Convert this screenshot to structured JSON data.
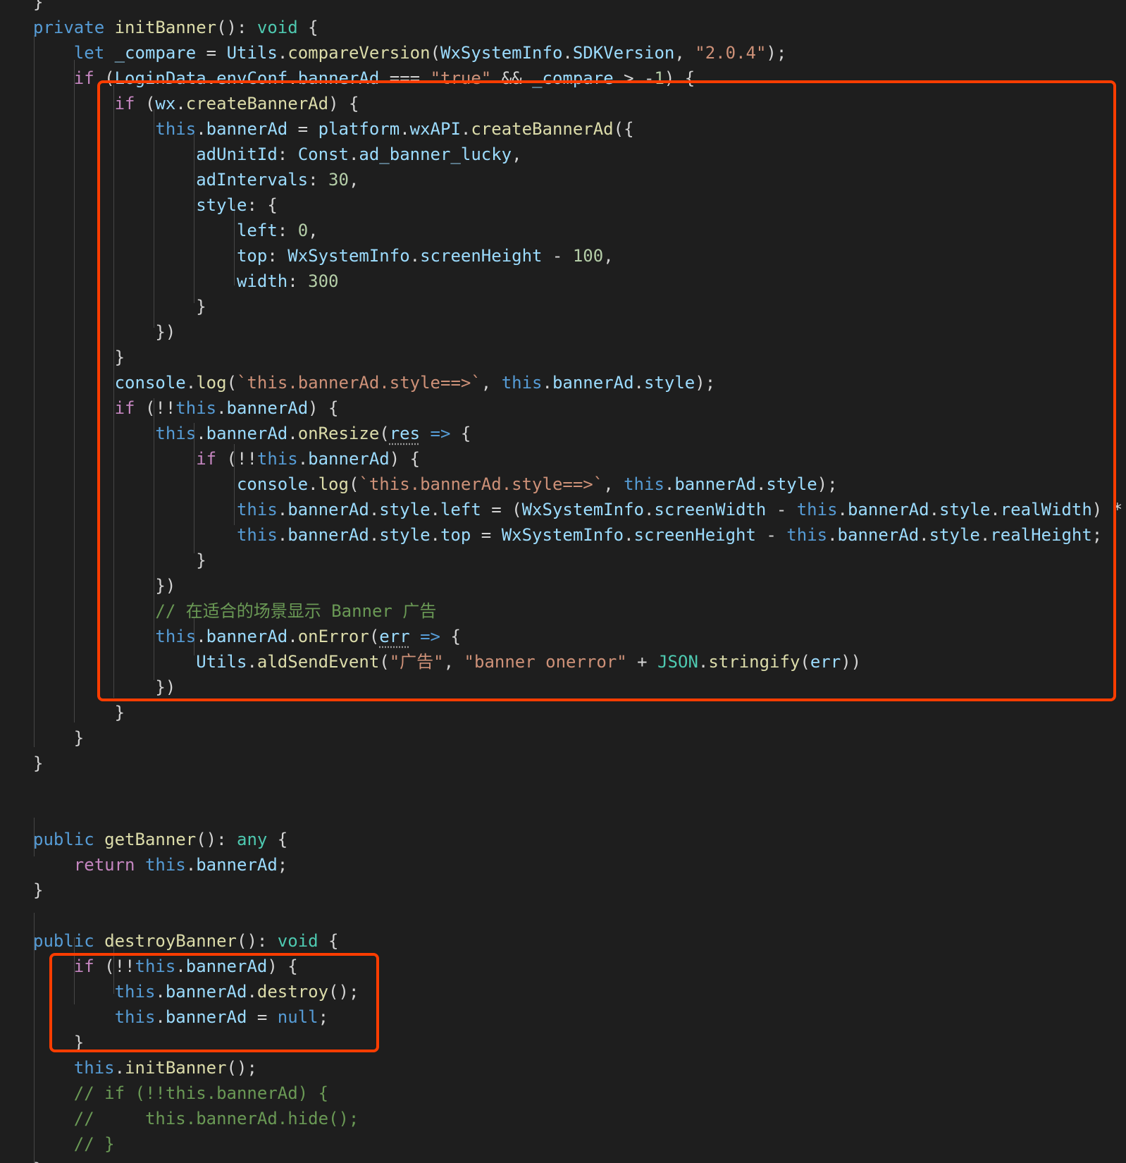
{
  "colors": {
    "background": "#1e1e1e",
    "keyword_control": "#c586c0",
    "keyword_storage": "#569cd6",
    "function": "#dcdcaa",
    "variable": "#9cdcfe",
    "class_type": "#4ec9b0",
    "string": "#ce9178",
    "number": "#b5cea8",
    "comment": "#6a9955",
    "punctuation": "#d4d4d4",
    "highlight_border": "#ff3d00"
  },
  "code": {
    "lines": [
      [
        {
          "t": "}",
          "c": "p"
        }
      ],
      [
        {
          "t": "private",
          "c": "s"
        },
        {
          "t": " "
        },
        {
          "t": "initBanner",
          "c": "f"
        },
        {
          "t": "(): "
        },
        {
          "t": "void",
          "c": "ty"
        },
        {
          "t": " {"
        }
      ],
      [
        {
          "t": "    "
        },
        {
          "t": "let",
          "c": "s"
        },
        {
          "t": " "
        },
        {
          "t": "_compare",
          "c": "v"
        },
        {
          "t": " = "
        },
        {
          "t": "Utils",
          "c": "v"
        },
        {
          "t": "."
        },
        {
          "t": "compareVersion",
          "c": "f"
        },
        {
          "t": "("
        },
        {
          "t": "WxSystemInfo",
          "c": "v"
        },
        {
          "t": "."
        },
        {
          "t": "SDKVersion",
          "c": "v"
        },
        {
          "t": ", "
        },
        {
          "t": "\"2.0.4\"",
          "c": "str"
        },
        {
          "t": ");"
        }
      ],
      [
        {
          "t": "    "
        },
        {
          "t": "if",
          "c": "k"
        },
        {
          "t": " ("
        },
        {
          "t": "LoginData",
          "c": "v"
        },
        {
          "t": "."
        },
        {
          "t": "envConf",
          "c": "v"
        },
        {
          "t": "."
        },
        {
          "t": "bannerAd",
          "c": "v"
        },
        {
          "t": " === "
        },
        {
          "t": "\"true\"",
          "c": "str"
        },
        {
          "t": " && "
        },
        {
          "t": "_compare",
          "c": "v"
        },
        {
          "t": " > -"
        },
        {
          "t": "1",
          "c": "n"
        },
        {
          "t": ") {"
        }
      ],
      [
        {
          "t": "        "
        },
        {
          "t": "if",
          "c": "k"
        },
        {
          "t": " ("
        },
        {
          "t": "wx",
          "c": "v"
        },
        {
          "t": "."
        },
        {
          "t": "createBannerAd",
          "c": "f"
        },
        {
          "t": ") {"
        }
      ],
      [
        {
          "t": "            "
        },
        {
          "t": "this",
          "c": "s"
        },
        {
          "t": "."
        },
        {
          "t": "bannerAd",
          "c": "v"
        },
        {
          "t": " = "
        },
        {
          "t": "platform",
          "c": "v"
        },
        {
          "t": "."
        },
        {
          "t": "wxAPI",
          "c": "v"
        },
        {
          "t": "."
        },
        {
          "t": "createBannerAd",
          "c": "f"
        },
        {
          "t": "({"
        }
      ],
      [
        {
          "t": "                "
        },
        {
          "t": "adUnitId",
          "c": "v"
        },
        {
          "t": ": "
        },
        {
          "t": "Const",
          "c": "v"
        },
        {
          "t": "."
        },
        {
          "t": "ad_banner_lucky",
          "c": "v"
        },
        {
          "t": ","
        }
      ],
      [
        {
          "t": "                "
        },
        {
          "t": "adIntervals",
          "c": "v"
        },
        {
          "t": ": "
        },
        {
          "t": "30",
          "c": "n"
        },
        {
          "t": ","
        }
      ],
      [
        {
          "t": "                "
        },
        {
          "t": "style",
          "c": "v"
        },
        {
          "t": ": {"
        }
      ],
      [
        {
          "t": "                    "
        },
        {
          "t": "left",
          "c": "v"
        },
        {
          "t": ": "
        },
        {
          "t": "0",
          "c": "n"
        },
        {
          "t": ","
        }
      ],
      [
        {
          "t": "                    "
        },
        {
          "t": "top",
          "c": "v"
        },
        {
          "t": ": "
        },
        {
          "t": "WxSystemInfo",
          "c": "v"
        },
        {
          "t": "."
        },
        {
          "t": "screenHeight",
          "c": "v"
        },
        {
          "t": " - "
        },
        {
          "t": "100",
          "c": "n"
        },
        {
          "t": ","
        }
      ],
      [
        {
          "t": "                    "
        },
        {
          "t": "width",
          "c": "v"
        },
        {
          "t": ": "
        },
        {
          "t": "300",
          "c": "n"
        }
      ],
      [
        {
          "t": "                }"
        }
      ],
      [
        {
          "t": "            })"
        }
      ],
      [
        {
          "t": "        }"
        }
      ],
      [
        {
          "t": "        "
        },
        {
          "t": "console",
          "c": "v"
        },
        {
          "t": "."
        },
        {
          "t": "log",
          "c": "f"
        },
        {
          "t": "("
        },
        {
          "t": "`this.bannerAd.style==>`",
          "c": "str"
        },
        {
          "t": ", "
        },
        {
          "t": "this",
          "c": "s"
        },
        {
          "t": "."
        },
        {
          "t": "bannerAd",
          "c": "v"
        },
        {
          "t": "."
        },
        {
          "t": "style",
          "c": "v"
        },
        {
          "t": ");"
        }
      ],
      [
        {
          "t": "        "
        },
        {
          "t": "if",
          "c": "k"
        },
        {
          "t": " (!!"
        },
        {
          "t": "this",
          "c": "s"
        },
        {
          "t": "."
        },
        {
          "t": "bannerAd",
          "c": "v"
        },
        {
          "t": ") {"
        }
      ],
      [
        {
          "t": "            "
        },
        {
          "t": "this",
          "c": "s"
        },
        {
          "t": "."
        },
        {
          "t": "bannerAd",
          "c": "v"
        },
        {
          "t": "."
        },
        {
          "t": "onResize",
          "c": "f"
        },
        {
          "t": "("
        },
        {
          "t": "res",
          "c": "v",
          "u": true
        },
        {
          "t": " "
        },
        {
          "t": "=>",
          "c": "s"
        },
        {
          "t": " {"
        }
      ],
      [
        {
          "t": "                "
        },
        {
          "t": "if",
          "c": "k"
        },
        {
          "t": " (!!"
        },
        {
          "t": "this",
          "c": "s"
        },
        {
          "t": "."
        },
        {
          "t": "bannerAd",
          "c": "v"
        },
        {
          "t": ") {"
        }
      ],
      [
        {
          "t": "                    "
        },
        {
          "t": "console",
          "c": "v"
        },
        {
          "t": "."
        },
        {
          "t": "log",
          "c": "f"
        },
        {
          "t": "("
        },
        {
          "t": "`this.bannerAd.style==>`",
          "c": "str"
        },
        {
          "t": ", "
        },
        {
          "t": "this",
          "c": "s"
        },
        {
          "t": "."
        },
        {
          "t": "bannerAd",
          "c": "v"
        },
        {
          "t": "."
        },
        {
          "t": "style",
          "c": "v"
        },
        {
          "t": ");"
        }
      ],
      [
        {
          "t": "                    "
        },
        {
          "t": "this",
          "c": "s"
        },
        {
          "t": "."
        },
        {
          "t": "bannerAd",
          "c": "v"
        },
        {
          "t": "."
        },
        {
          "t": "style",
          "c": "v"
        },
        {
          "t": "."
        },
        {
          "t": "left",
          "c": "v"
        },
        {
          "t": " = ("
        },
        {
          "t": "WxSystemInfo",
          "c": "v"
        },
        {
          "t": "."
        },
        {
          "t": "screenWidth",
          "c": "v"
        },
        {
          "t": " - "
        },
        {
          "t": "this",
          "c": "s"
        },
        {
          "t": "."
        },
        {
          "t": "bannerAd",
          "c": "v"
        },
        {
          "t": "."
        },
        {
          "t": "style",
          "c": "v"
        },
        {
          "t": "."
        },
        {
          "t": "realWidth",
          "c": "v"
        },
        {
          "t": ") *"
        }
      ],
      [
        {
          "t": "                    "
        },
        {
          "t": "this",
          "c": "s"
        },
        {
          "t": "."
        },
        {
          "t": "bannerAd",
          "c": "v"
        },
        {
          "t": "."
        },
        {
          "t": "style",
          "c": "v"
        },
        {
          "t": "."
        },
        {
          "t": "top",
          "c": "v"
        },
        {
          "t": " = "
        },
        {
          "t": "WxSystemInfo",
          "c": "v"
        },
        {
          "t": "."
        },
        {
          "t": "screenHeight",
          "c": "v"
        },
        {
          "t": " - "
        },
        {
          "t": "this",
          "c": "s"
        },
        {
          "t": "."
        },
        {
          "t": "bannerAd",
          "c": "v"
        },
        {
          "t": "."
        },
        {
          "t": "style",
          "c": "v"
        },
        {
          "t": "."
        },
        {
          "t": "realHeight",
          "c": "v"
        },
        {
          "t": ";"
        }
      ],
      [
        {
          "t": "                }"
        }
      ],
      [
        {
          "t": "            })"
        }
      ],
      [
        {
          "t": "            "
        },
        {
          "t": "// 在适合的场景显示 Banner 广告",
          "c": "cm"
        }
      ],
      [
        {
          "t": "            "
        },
        {
          "t": "this",
          "c": "s"
        },
        {
          "t": "."
        },
        {
          "t": "bannerAd",
          "c": "v"
        },
        {
          "t": "."
        },
        {
          "t": "onError",
          "c": "f"
        },
        {
          "t": "("
        },
        {
          "t": "err",
          "c": "v",
          "u": true
        },
        {
          "t": " "
        },
        {
          "t": "=>",
          "c": "s"
        },
        {
          "t": " {"
        }
      ],
      [
        {
          "t": "                "
        },
        {
          "t": "Utils",
          "c": "v"
        },
        {
          "t": "."
        },
        {
          "t": "aldSendEvent",
          "c": "f"
        },
        {
          "t": "("
        },
        {
          "t": "\"广告\"",
          "c": "str"
        },
        {
          "t": ", "
        },
        {
          "t": "\"banner onerror\"",
          "c": "str"
        },
        {
          "t": " + "
        },
        {
          "t": "JSON",
          "c": "ty"
        },
        {
          "t": "."
        },
        {
          "t": "stringify",
          "c": "f"
        },
        {
          "t": "("
        },
        {
          "t": "err",
          "c": "v"
        },
        {
          "t": "))"
        }
      ],
      [
        {
          "t": "            })"
        }
      ],
      [
        {
          "t": "        }"
        }
      ],
      [
        {
          "t": "    }"
        }
      ],
      [
        {
          "t": "}"
        }
      ],
      [],
      [],
      [
        {
          "t": "public",
          "c": "s"
        },
        {
          "t": " "
        },
        {
          "t": "getBanner",
          "c": "f"
        },
        {
          "t": "(): "
        },
        {
          "t": "any",
          "c": "ty"
        },
        {
          "t": " {"
        }
      ],
      [
        {
          "t": "    "
        },
        {
          "t": "return",
          "c": "k"
        },
        {
          "t": " "
        },
        {
          "t": "this",
          "c": "s"
        },
        {
          "t": "."
        },
        {
          "t": "bannerAd",
          "c": "v"
        },
        {
          "t": ";"
        }
      ],
      [
        {
          "t": "}"
        }
      ],
      [],
      [
        {
          "t": "public",
          "c": "s"
        },
        {
          "t": " "
        },
        {
          "t": "destroyBanner",
          "c": "f"
        },
        {
          "t": "(): "
        },
        {
          "t": "void",
          "c": "ty"
        },
        {
          "t": " {"
        }
      ],
      [
        {
          "t": "    "
        },
        {
          "t": "if",
          "c": "k"
        },
        {
          "t": " (!!"
        },
        {
          "t": "this",
          "c": "s"
        },
        {
          "t": "."
        },
        {
          "t": "bannerAd",
          "c": "v"
        },
        {
          "t": ") {"
        }
      ],
      [
        {
          "t": "        "
        },
        {
          "t": "this",
          "c": "s"
        },
        {
          "t": "."
        },
        {
          "t": "bannerAd",
          "c": "v"
        },
        {
          "t": "."
        },
        {
          "t": "destroy",
          "c": "f"
        },
        {
          "t": "();"
        }
      ],
      [
        {
          "t": "        "
        },
        {
          "t": "this",
          "c": "s"
        },
        {
          "t": "."
        },
        {
          "t": "bannerAd",
          "c": "v"
        },
        {
          "t": " = "
        },
        {
          "t": "null",
          "c": "s"
        },
        {
          "t": ";"
        }
      ],
      [
        {
          "t": "    }"
        }
      ],
      [
        {
          "t": "    "
        },
        {
          "t": "this",
          "c": "s"
        },
        {
          "t": "."
        },
        {
          "t": "initBanner",
          "c": "f"
        },
        {
          "t": "();"
        }
      ],
      [
        {
          "t": "    "
        },
        {
          "t": "// if (!!this.bannerAd) {",
          "c": "cm"
        }
      ],
      [
        {
          "t": "    "
        },
        {
          "t": "//     this.bannerAd.hide();",
          "c": "cm"
        }
      ],
      [
        {
          "t": "    "
        },
        {
          "t": "// }",
          "c": "cm"
        }
      ],
      [
        {
          "t": "}"
        }
      ]
    ]
  }
}
